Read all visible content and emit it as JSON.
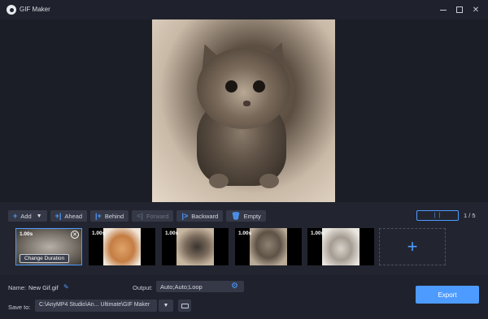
{
  "window": {
    "title": "GIF Maker"
  },
  "toolbar": {
    "add_label": "Add",
    "ahead_label": "Ahead",
    "behind_label": "Behind",
    "forward_label": "Forward",
    "backward_label": "Backward",
    "empty_label": "Empty"
  },
  "playback": {
    "page_indicator": "1 / 5"
  },
  "frames": [
    {
      "duration": "1.00s",
      "selected": true,
      "hover_label": "Change Duration"
    },
    {
      "duration": "1.00s",
      "selected": false
    },
    {
      "duration": "1.00s",
      "selected": false
    },
    {
      "duration": "1.00s",
      "selected": false
    },
    {
      "duration": "1.00s",
      "selected": false
    }
  ],
  "settings": {
    "name_label": "Name:",
    "name_value": "New Gif.gif",
    "output_label": "Output:",
    "output_value": "Auto;Auto;Loop",
    "save_label": "Save to:",
    "save_path": "C:\\AnyMP4 Studio\\An... Ultimate\\GIF Maker",
    "export_label": "Export"
  },
  "colors": {
    "accent": "#4e9bff",
    "background": "#1b1e27",
    "panel": "#22252f"
  }
}
